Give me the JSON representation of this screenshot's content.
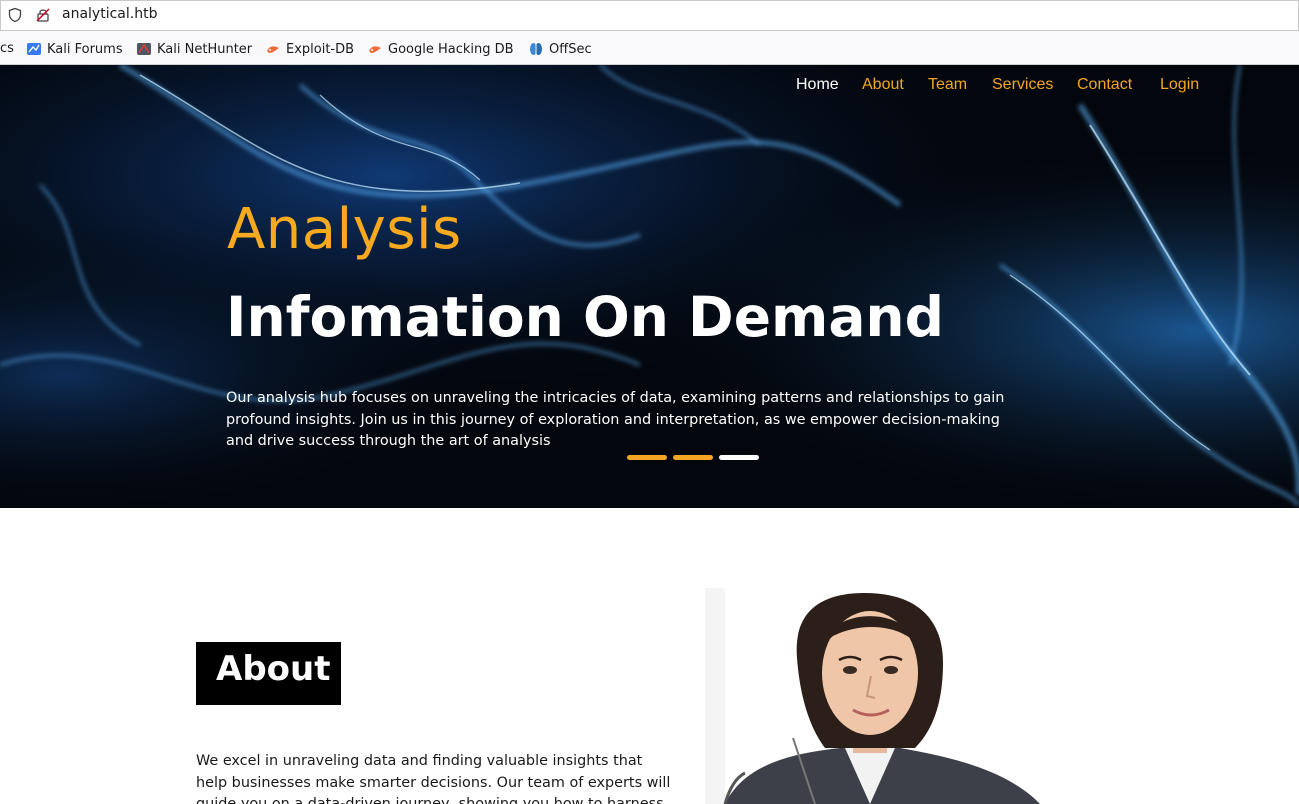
{
  "browser": {
    "url": "analytical.htb",
    "bookmarks": [
      {
        "label": "cs",
        "icon": "none"
      },
      {
        "label": "Kali Forums",
        "icon": "kali-forums-icon"
      },
      {
        "label": "Kali NetHunter",
        "icon": "kali-nethunter-icon"
      },
      {
        "label": "Exploit-DB",
        "icon": "exploit-db-icon"
      },
      {
        "label": "Google Hacking DB",
        "icon": "ghdb-icon"
      },
      {
        "label": "OffSec",
        "icon": "offsec-icon"
      }
    ]
  },
  "nav": {
    "items": [
      {
        "label": "Home",
        "active": true
      },
      {
        "label": "About",
        "active": false
      },
      {
        "label": "Team",
        "active": false
      },
      {
        "label": "Services",
        "active": false
      },
      {
        "label": "Contact",
        "active": false
      },
      {
        "label": "Login",
        "active": false
      }
    ]
  },
  "hero": {
    "subtitle": "Analysis",
    "title": "Infomation On Demand",
    "description": "Our analysis hub focuses on unraveling the intricacies of data, examining patterns and relationships to gain profound insights. Join us in this journey of exploration and interpretation, as we empower decision-making and drive success through the art of analysis",
    "slides": 3,
    "active_slide": 3
  },
  "about": {
    "heading": "About",
    "text": "We excel in unraveling data and finding valuable insights that help businesses make smarter decisions. Our team of experts will guide you on a data-driven journey, showing you how to harness the"
  },
  "colors": {
    "accent": "#f5a623",
    "hero_bg": "#04070d",
    "white": "#ffffff"
  }
}
